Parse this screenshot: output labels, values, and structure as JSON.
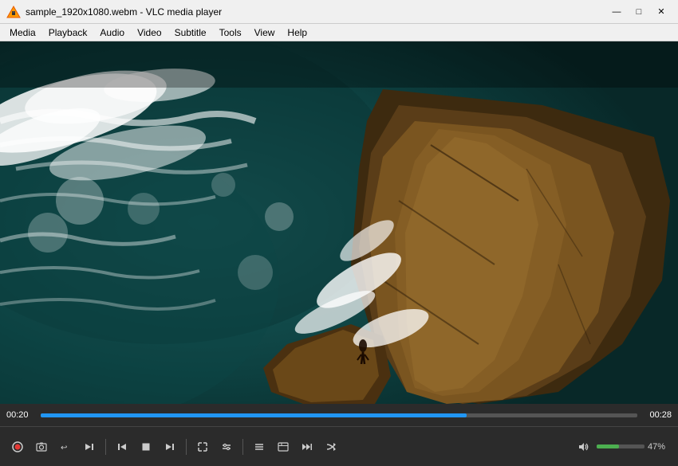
{
  "titlebar": {
    "title": "sample_1920x1080.webm - VLC media player",
    "minimize_label": "—",
    "maximize_label": "□",
    "close_label": "✕"
  },
  "menubar": {
    "items": [
      "Media",
      "Playback",
      "Audio",
      "Video",
      "Subtitle",
      "Tools",
      "View",
      "Help"
    ]
  },
  "player": {
    "time_current": "00:20",
    "time_total": "00:28",
    "volume_pct": "47%"
  },
  "controls": {
    "record": "⏺",
    "screenshot": "📷",
    "loop": "🔁",
    "frame_next": "⏭",
    "prev": "⏮",
    "stop": "⏹",
    "next": "⏭",
    "fullscreen": "⛶",
    "extended": "⚙",
    "playlist": "☰",
    "effects": "✦",
    "frame_by_frame": "⏯",
    "random": "🔀",
    "repeat": "🔂"
  }
}
